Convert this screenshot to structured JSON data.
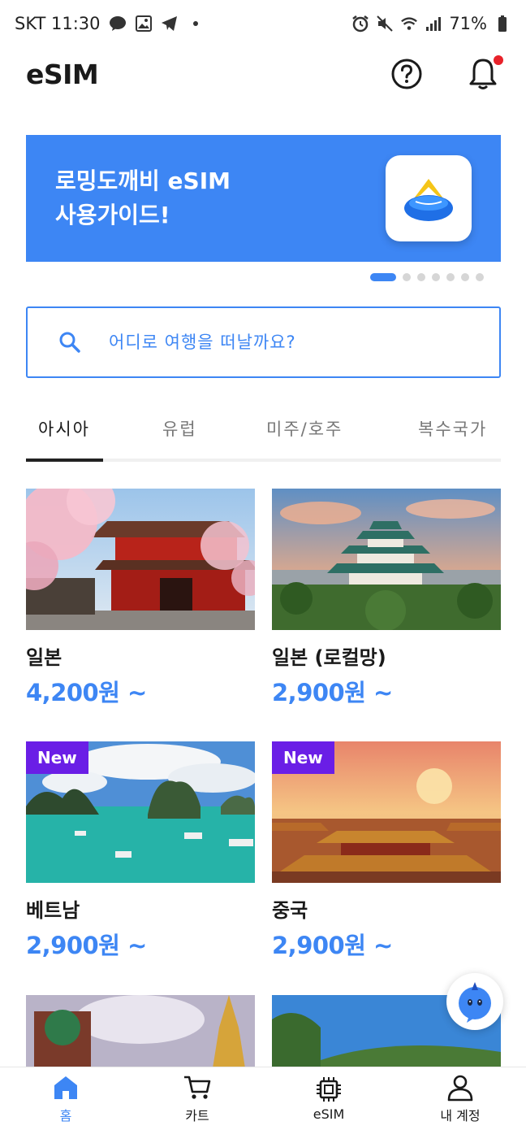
{
  "status_bar": {
    "carrier_time": "SKT 11:30",
    "battery": "71%"
  },
  "header": {
    "title": "eSIM",
    "help_icon": "help-circle-icon",
    "bell_icon": "bell-icon"
  },
  "banner": {
    "text": "로밍도깨비 eSIM\n사용가이드!",
    "color": "#3d86f4",
    "active_slide": 1,
    "total_slides": 7
  },
  "search": {
    "placeholder": "어디로 여행을 떠날까요?"
  },
  "tabs": [
    {
      "label": "아시아",
      "active": true
    },
    {
      "label": "유럽",
      "active": false
    },
    {
      "label": "미주/호주",
      "active": false
    },
    {
      "label": "복수국가",
      "active": false
    }
  ],
  "products": [
    {
      "title": "일본",
      "price": "4,200원 ~",
      "badge": ""
    },
    {
      "title": "일본 (로컬망)",
      "price": "2,900원 ~",
      "badge": ""
    },
    {
      "title": "베트남",
      "price": "2,900원 ~",
      "badge": "New"
    },
    {
      "title": "중국",
      "price": "2,900원 ~",
      "badge": "New"
    }
  ],
  "bottom_nav": [
    {
      "label": "홈",
      "icon": "home-icon",
      "active": true
    },
    {
      "label": "카트",
      "icon": "cart-icon",
      "active": false
    },
    {
      "label": "eSIM",
      "icon": "chip-icon",
      "active": false
    },
    {
      "label": "내 계정",
      "icon": "user-icon",
      "active": false
    }
  ],
  "colors": {
    "accent": "#3d86f4",
    "badge": "#6a1ee6",
    "notification_dot": "#e8222a"
  }
}
